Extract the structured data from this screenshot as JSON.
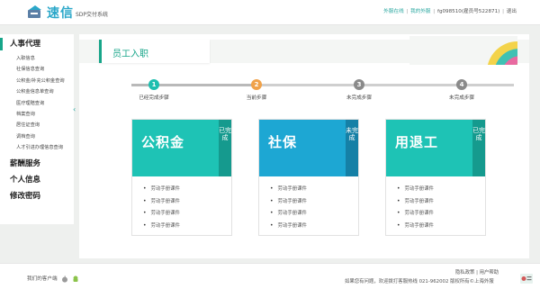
{
  "header": {
    "logo_text": "速信",
    "system_name": "SDP交付系统",
    "links": {
      "online": "外服在线",
      "mine": "我的外服",
      "user": "fg098510(雇员号522871)",
      "logout": "退出"
    },
    "separator": "|"
  },
  "sidebar": {
    "groups": [
      {
        "label": "人事代理",
        "items": [
          "入职信息",
          "社保信息查询",
          "公积金/补充公积金查询",
          "公积金信息单查询",
          "医疗理赔查询",
          "档案查询",
          "居住证查询",
          "调档查询",
          "人才引进办理信息查询"
        ]
      },
      {
        "label": "薪酬服务",
        "items": []
      },
      {
        "label": "个人信息",
        "items": []
      },
      {
        "label": "修改密码",
        "items": []
      }
    ]
  },
  "main": {
    "title": "员工入职",
    "steps": [
      {
        "num": "1",
        "label": "已经完成步骤",
        "color": "#1dbfaf"
      },
      {
        "num": "2",
        "label": "当前步骤",
        "color": "#f0a24a"
      },
      {
        "num": "3",
        "label": "未完成步骤",
        "color": "#8a8a8a"
      },
      {
        "num": "4",
        "label": "未完成步骤",
        "color": "#8a8a8a"
      }
    ],
    "cards": [
      {
        "title": "公积金",
        "status": "已完成",
        "head_color": "#1ec3b5",
        "status_color": "#159a8e",
        "items": [
          "劳动手册课件",
          "劳动手册课件",
          "劳动手册课件",
          "劳动手册课件"
        ]
      },
      {
        "title": "社保",
        "status": "未完成",
        "head_color": "#1da7d3",
        "status_color": "#1580a6",
        "items": [
          "劳动手册课件",
          "劳动手册课件",
          "劳动手册课件",
          "劳动手册课件"
        ]
      },
      {
        "title": "用退工",
        "status": "已完成",
        "head_color": "#1ec3b5",
        "status_color": "#159a8e",
        "items": [
          "劳动手册课件",
          "劳动手册课件",
          "劳动手册课件",
          "劳动手册课件"
        ]
      }
    ]
  },
  "footer": {
    "client_text": "我们的客户端",
    "links": "隐私政策 | 用户帮助",
    "copyright": "如果您有问题，欢迎拨打客服热线 021-962002 版权所有©上海外服"
  }
}
